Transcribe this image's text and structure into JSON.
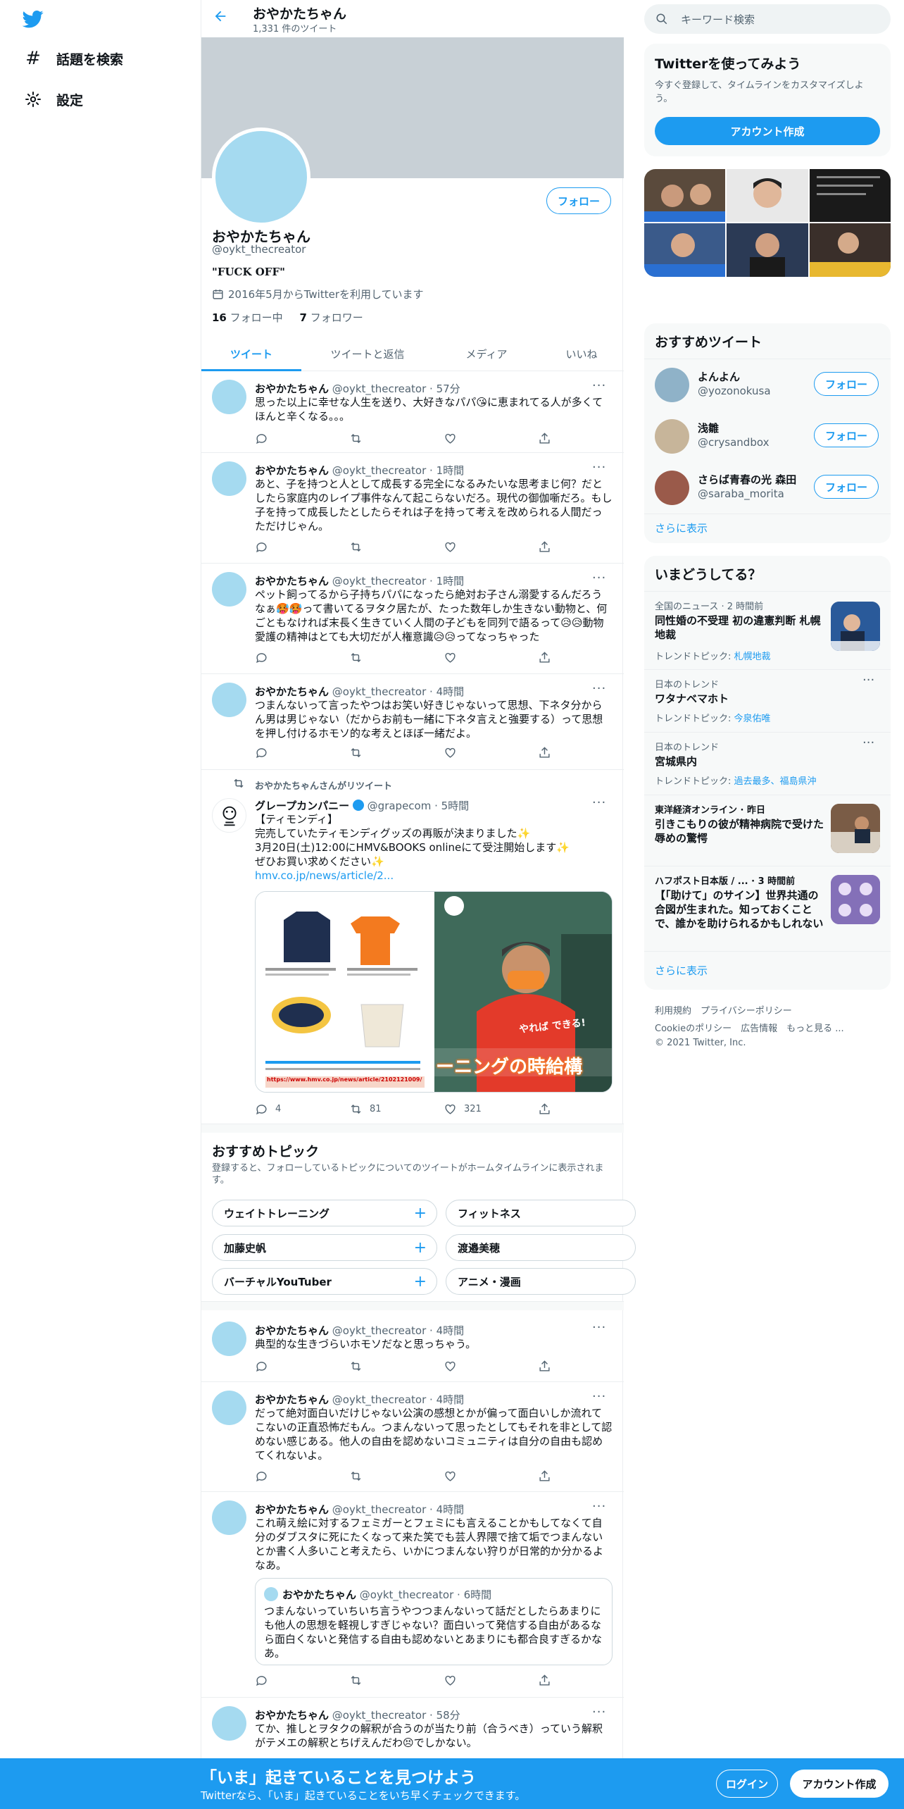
{
  "nav": {
    "explore_label": "話題を検索",
    "settings_label": "設定"
  },
  "header": {
    "title": "おやかたちゃん",
    "subtitle": "1,331 件のツイート"
  },
  "profile": {
    "name": "おやかたちゃん",
    "handle": "@oykt_thecreator",
    "bio": "\"FUCK OFF\"",
    "joined": "2016年5月からTwitterを利用しています",
    "following_count": "16",
    "following_label": "フォロー中",
    "followers_count": "7",
    "followers_label": "フォロワー",
    "follow_label": "フォロー"
  },
  "tabs": [
    "ツイート",
    "ツイートと返信",
    "メディア",
    "いいね"
  ],
  "tweets": [
    {
      "name": "おやかたちゃん",
      "meta": "@oykt_thecreator · 57分",
      "text": "思った以上に幸せな人生を送り、大好きなパパ😘に恵まれてる人が多くてほんと辛くなる。。。"
    },
    {
      "name": "おやかたちゃん",
      "meta": "@oykt_thecreator · 1時間",
      "text": "あと、子を持つと人として成長する完全になるみたいな思考まじ何？だとしたら家庭内のレイプ事件なんて起こらないだろ。現代の御伽噺だろ。もし子を持って成長したとしたらそれは子を持って考えを改められる人間だっただけじゃん。"
    },
    {
      "name": "おやかたちゃん",
      "meta": "@oykt_thecreator · 1時間",
      "text": "ペット飼ってるから子持ちパパになったら絶対お子さん溺愛するんだろうなぁ🥵🥵って書いてるヲタク居たが、たった数年しか生きない動物と、何ごともなければ末長く生きていく人間の子どもを同列で語るって😥😥動物愛護の精神はとても大切だが人権意識😥😥ってなっちゃった"
    },
    {
      "name": "おやかたちゃん",
      "meta": "@oykt_thecreator · 4時間",
      "text": "つまんないって言ったやつはお笑い好きじゃないって思想、下ネタ分からん男は男じゃない（だからお前も一緒に下ネタ言えと強要する）って思想を押し付けるホモソ的な考えとほぼ一緒だよ。"
    }
  ],
  "retweet": {
    "by": "おやかたちゃんさんがリツイート",
    "name": "グレープカンパニー",
    "meta": "@grapecom · 5時間",
    "line1": "【ティモンディ】",
    "line2": "完売していたティモンディグッズの再販が決まりました✨",
    "line3": "3月20日(土)12:00にHMV&BOOKS onlineにて受注開始します✨",
    "line4": "ぜひお買い求めください✨",
    "link": "hmv.co.jp/news/article/2...",
    "replies": "4",
    "retweets": "81",
    "likes": "321",
    "img_caption": "ーニングの時給構",
    "img_tag": "やれば できる!",
    "img_link": "https://www.hmv.co.jp/news/article/2102121009/"
  },
  "topics": {
    "title": "おすすめトピック",
    "desc": "登録すると、フォローしているトピックについてのツイートがホームタイムラインに表示されます。",
    "chips": [
      "ウェイトトレーニング",
      "フィットネス",
      "加藤史帆",
      "渡邉美穂",
      "バーチャルYouTuber",
      "アニメ・漫画"
    ]
  },
  "tweets2": [
    {
      "name": "おやかたちゃん",
      "meta": "@oykt_thecreator · 4時間",
      "text": "典型的な生きづらいホモソだなと思っちゃう。"
    },
    {
      "name": "おやかたちゃん",
      "meta": "@oykt_thecreator · 4時間",
      "text": "だって絶対面白いだけじゃない公演の感想とかが偏って面白いしか流れてこないの正直恐怖だもん。つまんないって思ったとしてもそれを非として認めない感じある。他人の自由を認めないコミュニティは自分の自由も認めてくれないよ。"
    },
    {
      "name": "おやかたちゃん",
      "meta": "@oykt_thecreator · 4時間",
      "text": "これ萌え絵に対するフェミガーとフェミにも言えることかもしてなくて自分のダブスタに死にたくなって来た笑でも芸人界隈で捨て垢でつまんないとか書く人多いこと考えたら、いかにつまんない狩りが日常的か分かるよなあ。"
    },
    {
      "name": "おやかたちゃん",
      "meta": "@oykt_thecreator · 58分",
      "text": "てか、推しとヲタクの解釈が合うのが当たり前（合うべき）っていう解釈がテメエの解釈とちげえんだわ😣でしかない。"
    }
  ],
  "quote": {
    "name": "おやかたちゃん",
    "meta": "@oykt_thecreator · 6時間",
    "text": "つまんないっていちいち言うやつつまんないって話だとしたらあまりにも他人の思想を軽視しすぎじゃない？面白いって発信する自由があるなら面白くないと発信する自由も認めないとあまりにも都合良すぎるかなあ。"
  },
  "right": {
    "search_placeholder": "キーワード検索",
    "signup_card": {
      "title": "Twitterを使ってみよう",
      "desc": "今すぐ登録して、タイムラインをカスタマイズしよう。",
      "cta": "アカウント作成"
    },
    "recommended": {
      "title": "おすすめツイート",
      "users": [
        {
          "name": "よんよん",
          "handle": "@yozonokusa",
          "follow": "フォロー"
        },
        {
          "name": "浅雛",
          "handle": "@crysandbox",
          "follow": "フォロー"
        },
        {
          "name": "さらば青春の光 森田",
          "handle": "@saraba_morita",
          "follow": "フォロー"
        }
      ],
      "more": "さらに表示"
    },
    "trends": {
      "title": "いまどうしてる？",
      "items": [
        {
          "ctx": "全国のニュース · 2 時間前",
          "title": "同性婚の不受理 初の違憲判断 札幌地裁",
          "sub_label": "トレンドトピック: ",
          "sub_link": "札幌地裁"
        },
        {
          "ctx": "日本のトレンド",
          "title": "ワタナベマホト",
          "sub_label": "トレンドトピック: ",
          "sub_link": "今泉佑唯"
        },
        {
          "ctx": "日本のトレンド",
          "title": "宮城県内",
          "sub_label": "トレンドトピック: ",
          "sub_link": "過去最多、福島県沖"
        },
        {
          "ctx": "東洋経済オンライン · 昨日",
          "title": "引きこもりの彼が精神病院で受けた辱めの驚愕",
          "sub_label": "",
          "sub_link": ""
        },
        {
          "ctx": "ハフポスト日本版 / ... · 3 時間前",
          "title": "【「助けて」のサイン】世界共通の合図が生まれた。知っておくことで、誰かを助けられるかもしれない",
          "sub_label": "",
          "sub_link": ""
        }
      ],
      "more": "さらに表示"
    },
    "footer": {
      "l1": "利用規約　プライバシーポリシー",
      "l2": "Cookieのポリシー　広告情報　もっと見る ...",
      "l3": "© 2021 Twitter, Inc."
    }
  },
  "bottom": {
    "title": "「いま」起きていることを見つけよう",
    "sub": "Twitterなら、「いま」起きていることをいち早くチェックできます。",
    "login": "ログイン",
    "signup": "アカウント作成"
  },
  "colors": {
    "accent": "#1d9bf0",
    "banner": "#c8d0d6",
    "avatar": "#a5daf0"
  }
}
